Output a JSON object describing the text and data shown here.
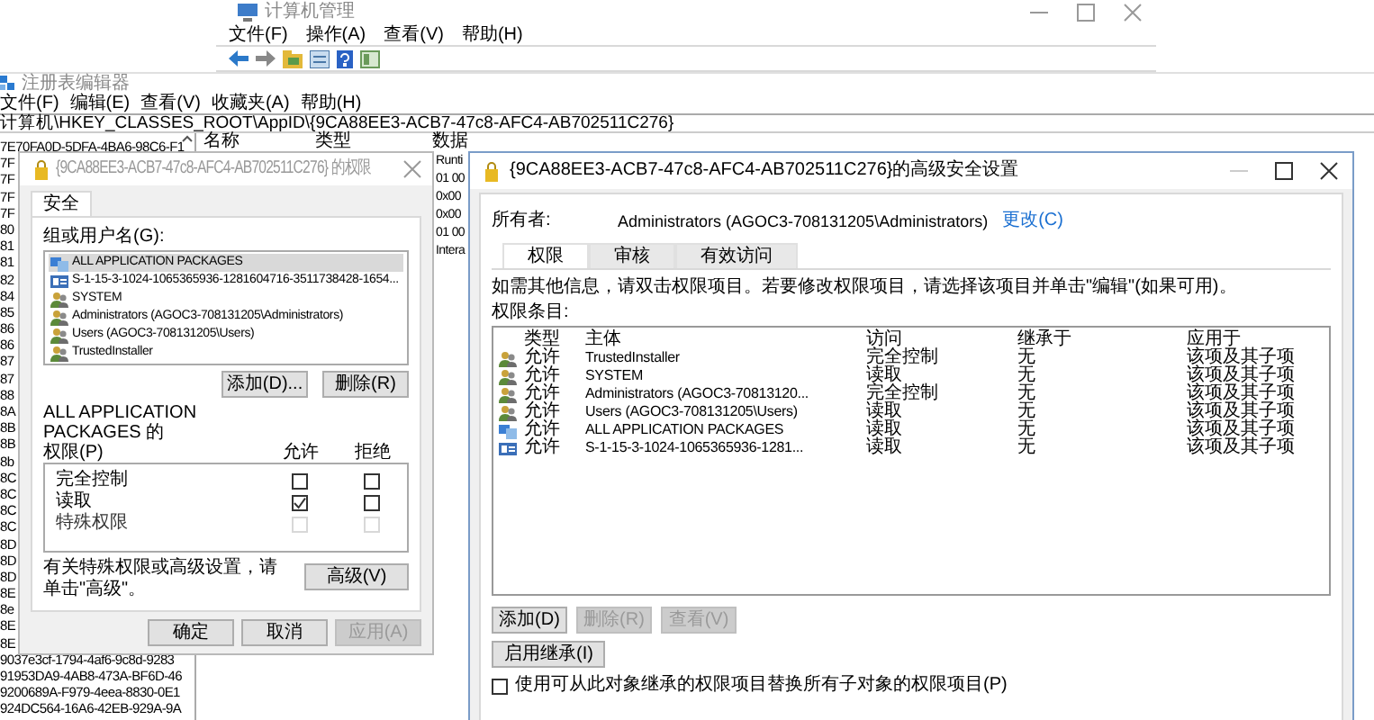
{
  "computer_management": {
    "title": "计算机管理",
    "menu": [
      "文件(F)",
      "操作(A)",
      "查看(V)",
      "帮助(H)"
    ]
  },
  "registry_editor": {
    "title": "注册表编辑器",
    "menu": [
      "文件(F)",
      "编辑(E)",
      "查看(V)",
      "收藏夹(A)",
      "帮助(H)"
    ],
    "address": "计算机\\HKEY_CLASSES_ROOT\\AppID\\{9CA88EE3-ACB7-47c8-AFC4-AB702511C276}",
    "tree_items": [
      "7E70FA0D-5DFA-4BA6-98C6-F1",
      "7F",
      "7F",
      "7F",
      "7F",
      "80",
      "81",
      "81",
      "82",
      "84",
      "85",
      "86",
      "86",
      "87",
      "87",
      "88",
      "8A",
      "8B",
      "8B",
      "8b",
      "8C",
      "8C",
      "8C",
      "8C",
      "8D",
      "8D",
      "8D",
      "8E",
      "8e",
      "8E",
      "8E",
      "9037e3cf-1794-4af6-9c8d-9283",
      "91953DA9-4AB8-473A-BF6D-46",
      "9200689A-F979-4eea-8830-0E1",
      "924DC564-16A6-42EB-929A-9A"
    ],
    "columns": [
      "名称",
      "类型",
      "数据"
    ],
    "data_values": [
      "Runti",
      "01 00",
      "0x00",
      "0x00",
      "01 00",
      "Intera"
    ]
  },
  "permissions_dialog": {
    "title": "{9CA88EE3-ACB7-47c8-AFC4-AB702511C276} 的权限",
    "tabs": [
      {
        "label": "安全",
        "selected": true
      }
    ],
    "group_label": "组或用户名(G):",
    "users": [
      {
        "kind": "package",
        "name": "ALL APPLICATION PACKAGES",
        "selected": true
      },
      {
        "kind": "sid",
        "name": "S-1-15-3-1024-1065365936-1281604716-3511738428-1654...",
        "selected": false
      },
      {
        "kind": "user",
        "name": "SYSTEM",
        "selected": false
      },
      {
        "kind": "user",
        "name": "Administrators (AGOC3-708131205\\Administrators)",
        "selected": false
      },
      {
        "kind": "user",
        "name": "Users (AGOC3-708131205\\Users)",
        "selected": false
      },
      {
        "kind": "user",
        "name": "TrustedInstaller",
        "selected": false
      }
    ],
    "user_buttons": [
      {
        "label": "添加(D)...",
        "disabled": false
      },
      {
        "label": "删除(R)",
        "disabled": false
      }
    ],
    "permissions_for": "ALL APPLICATION PACKAGES 的",
    "permissions_label": "权限(P)",
    "allow_header": "允许",
    "deny_header": "拒绝",
    "permissions": [
      {
        "name": "完全控制",
        "allow": false,
        "deny": false,
        "disabled": false
      },
      {
        "name": "读取",
        "allow": true,
        "deny": false,
        "disabled": false
      },
      {
        "name": "特殊权限",
        "allow": false,
        "deny": false,
        "disabled": true
      }
    ],
    "note": "有关特殊权限或高级设置，请单击\"高级\"。",
    "advanced_button": "高级(V)",
    "buttons": [
      {
        "label": "确定",
        "disabled": false
      },
      {
        "label": "取消",
        "disabled": false
      },
      {
        "label": "应用(A)",
        "disabled": true
      }
    ]
  },
  "advanced_dialog": {
    "title": "{9CA88EE3-ACB7-47c8-AFC4-AB702511C276}的高级安全设置",
    "owner_label": "所有者:",
    "owner": "Administrators (AGOC3-708131205\\Administrators)",
    "change_link": "更改(C)",
    "tabs": [
      {
        "label": "权限",
        "selected": true
      },
      {
        "label": "审核",
        "selected": false
      },
      {
        "label": "有效访问",
        "selected": false
      }
    ],
    "info": "如需其他信息，请双击权限项目。若要修改权限项目，请选择该项目并单击\"编辑\"(如果可用)。",
    "entries_label": "权限条目:",
    "columns": [
      "类型",
      "主体",
      "访问",
      "继承于",
      "应用于"
    ],
    "entries": [
      {
        "kind": "user",
        "type": "允许",
        "principal": "TrustedInstaller",
        "access": "完全控制",
        "inherited_from": "无",
        "applies_to": "该项及其子项"
      },
      {
        "kind": "user",
        "type": "允许",
        "principal": "SYSTEM",
        "access": "读取",
        "inherited_from": "无",
        "applies_to": "该项及其子项"
      },
      {
        "kind": "user",
        "type": "允许",
        "principal": "Administrators (AGOC3-70813120...",
        "access": "完全控制",
        "inherited_from": "无",
        "applies_to": "该项及其子项"
      },
      {
        "kind": "user",
        "type": "允许",
        "principal": "Users (AGOC3-708131205\\Users)",
        "access": "读取",
        "inherited_from": "无",
        "applies_to": "该项及其子项"
      },
      {
        "kind": "package",
        "type": "允许",
        "principal": "ALL APPLICATION PACKAGES",
        "access": "读取",
        "inherited_from": "无",
        "applies_to": "该项及其子项"
      },
      {
        "kind": "sid",
        "type": "允许",
        "principal": "S-1-15-3-1024-1065365936-1281...",
        "access": "读取",
        "inherited_from": "无",
        "applies_to": "该项及其子项"
      }
    ],
    "entry_buttons": [
      {
        "label": "添加(D)",
        "disabled": false
      },
      {
        "label": "删除(R)",
        "disabled": true
      },
      {
        "label": "查看(V)",
        "disabled": true
      }
    ],
    "inherit_button": "启用继承(I)",
    "replace_checkbox": {
      "label": "使用可从此对象继承的权限项目替换所有子对象的权限项目(P)",
      "checked": false
    }
  }
}
